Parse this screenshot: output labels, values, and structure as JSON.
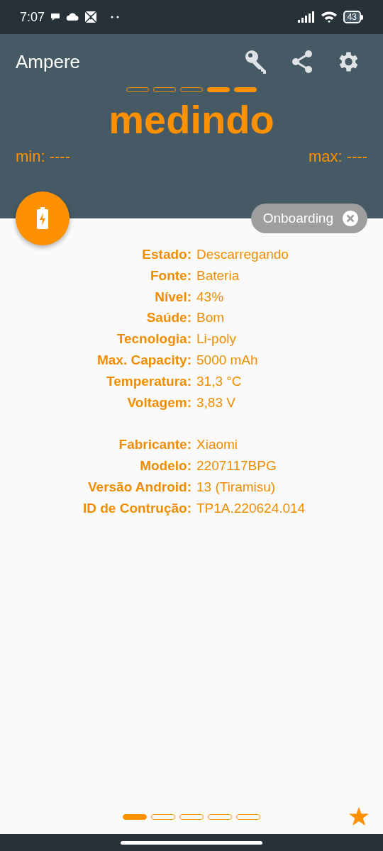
{
  "status_bar": {
    "time": "7:07",
    "battery": "43"
  },
  "app_bar": {
    "title": "Ampere"
  },
  "segments": [
    {
      "filled": false
    },
    {
      "filled": false
    },
    {
      "filled": false
    },
    {
      "filled": true
    },
    {
      "filled": true
    }
  ],
  "reading": "medindo",
  "min": "min: ----",
  "max": "max: ----",
  "chip": {
    "label": "Onboarding"
  },
  "groups": [
    {
      "rows": [
        {
          "label": "Estado:",
          "value": "Descarregando"
        },
        {
          "label": "Fonte:",
          "value": "Bateria"
        },
        {
          "label": "Nível:",
          "value": "43%"
        },
        {
          "label": "Saúde:",
          "value": "Bom"
        },
        {
          "label": "Tecnologia:",
          "value": "Li-poly"
        },
        {
          "label": "Max. Capacity:",
          "value": "5000 mAh"
        },
        {
          "label": "Temperatura:",
          "value": "31,3 °C"
        },
        {
          "label": "Voltagem:",
          "value": "3,83 V"
        }
      ]
    },
    {
      "rows": [
        {
          "label": "Fabricante:",
          "value": "Xiaomi"
        },
        {
          "label": "Modelo:",
          "value": "2207117BPG"
        },
        {
          "label": "Versão Android:",
          "value": "13 (Tiramisu)"
        },
        {
          "label": "ID de Contrução:",
          "value": "TP1A.220624.014"
        }
      ]
    }
  ],
  "pages": [
    {
      "selected": true
    },
    {
      "selected": false
    },
    {
      "selected": false
    },
    {
      "selected": false
    },
    {
      "selected": false
    }
  ]
}
